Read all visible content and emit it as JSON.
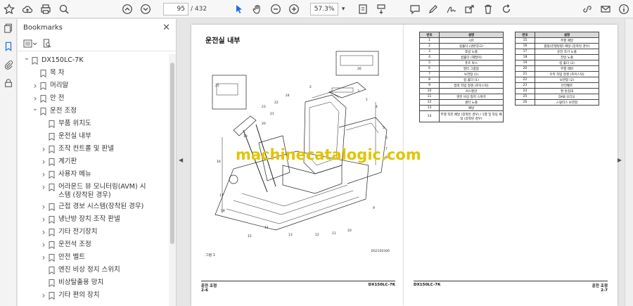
{
  "toolbar": {
    "page_current": "95",
    "page_total": "/ 432",
    "zoom": "57.3%"
  },
  "bookmarks": {
    "title": "Bookmarks",
    "items": [
      {
        "label": "DX150LC-7K",
        "level": 0,
        "chevron": "down"
      },
      {
        "label": "목 차",
        "level": 1,
        "chevron": "none"
      },
      {
        "label": "머리말",
        "level": 1,
        "chevron": "right"
      },
      {
        "label": "안 전",
        "level": 1,
        "chevron": "right"
      },
      {
        "label": "운전 조정",
        "level": 1,
        "chevron": "down"
      },
      {
        "label": "부품 위치도",
        "level": 2,
        "chevron": "none"
      },
      {
        "label": "운전실 내부",
        "level": 2,
        "chevron": "none"
      },
      {
        "label": "조작 컨트롤 및 판넬",
        "level": 2,
        "chevron": "right"
      },
      {
        "label": "계기판",
        "level": 2,
        "chevron": "right"
      },
      {
        "label": "사용자 메뉴",
        "level": 2,
        "chevron": "right"
      },
      {
        "label": "어라운드 뷰 모니터링(AVM) 시스템 (장착된 경우)",
        "level": 2,
        "chevron": "right"
      },
      {
        "label": "근접 경보 시스템(장착된 경우)",
        "level": 2,
        "chevron": "right"
      },
      {
        "label": "냉난방 장치 조작 판넬",
        "level": 2,
        "chevron": "right"
      },
      {
        "label": "기타 전기장치",
        "level": 2,
        "chevron": "right"
      },
      {
        "label": "운전석 조정",
        "level": 2,
        "chevron": "right"
      },
      {
        "label": "안전 벨트",
        "level": 2,
        "chevron": "right"
      },
      {
        "label": "엔진 비상 정지 스위치",
        "level": 2,
        "chevron": "none"
      },
      {
        "label": "비상탈출용 망치",
        "level": 2,
        "chevron": "none"
      },
      {
        "label": "기타 편의 장치",
        "level": 2,
        "chevron": "right"
      }
    ]
  },
  "left_page": {
    "heading": "운전실 내부",
    "figure_caption": "그림 1",
    "figure_code": "DS2100306",
    "footer_left_1": "운전 조정",
    "footer_left_2": "2-6",
    "footer_right": "DX150LC-7K",
    "callouts": [
      "1",
      "2",
      "3",
      "4",
      "5",
      "6",
      "7",
      "8",
      "9",
      "10",
      "11",
      "12",
      "13",
      "14",
      "15",
      "16",
      "17",
      "18",
      "19",
      "20",
      "21",
      "22",
      "23",
      "24",
      "25",
      "26"
    ]
  },
  "right_page": {
    "footer_left": "DX150LC-7K",
    "footer_right_1": "운전 조정",
    "footer_right_2": "2-7",
    "table_headers": [
      "번호",
      "설명"
    ],
    "table_left": [
      {
        "num": "1",
        "desc": "시트"
      },
      {
        "num": "2",
        "desc": "컵홀더 (냉온장고)"
      },
      {
        "num": "3",
        "desc": "후방 노즐"
      },
      {
        "num": "4",
        "desc": "컵홀더 (재떨이)"
      },
      {
        "num": "5",
        "desc": "퓨즈 박스"
      },
      {
        "num": "6",
        "desc": "멀티 그룹함"
      },
      {
        "num": "7",
        "desc": "보관함 (1)"
      },
      {
        "num": "8",
        "desc": "컵 홀더 (1)"
      },
      {
        "num": "9",
        "desc": "컵락 작업 정렌 (조이스틱)"
      },
      {
        "num": "10",
        "desc": "서스펜션"
      },
      {
        "num": "11",
        "desc": "엔진 비상 정지 스위치"
      },
      {
        "num": "12",
        "desc": "센터 노즐"
      },
      {
        "num": "13",
        "desc": "페달"
      },
      {
        "num": "14",
        "desc": "주행 직진 페달 (장착된 경우) / 1행 및 작동 페달 (장착된 경우)"
      }
    ],
    "table_right": [
      {
        "num": "15",
        "desc": "주행 페달"
      },
      {
        "num": "16",
        "desc": "펌핑(진행방향) 페달 (장착된 경우)"
      },
      {
        "num": "17",
        "desc": "운전 조기 노즐"
      },
      {
        "num": "18",
        "desc": "전방 노즐"
      },
      {
        "num": "19",
        "desc": "컵 홀더 (2)"
      },
      {
        "num": "20",
        "desc": "주행 레버"
      },
      {
        "num": "21",
        "desc": "우측 작업 정렌 (조이스틱)"
      },
      {
        "num": "22",
        "desc": "보관함 (2)"
      },
      {
        "num": "23",
        "desc": "안전벨트"
      },
      {
        "num": "24",
        "desc": "팔 받침대"
      },
      {
        "num": "25",
        "desc": "DAB 오디오"
      },
      {
        "num": "26",
        "desc": "스윙리스 보관함"
      }
    ]
  },
  "watermark": "machinecatalogic.com"
}
